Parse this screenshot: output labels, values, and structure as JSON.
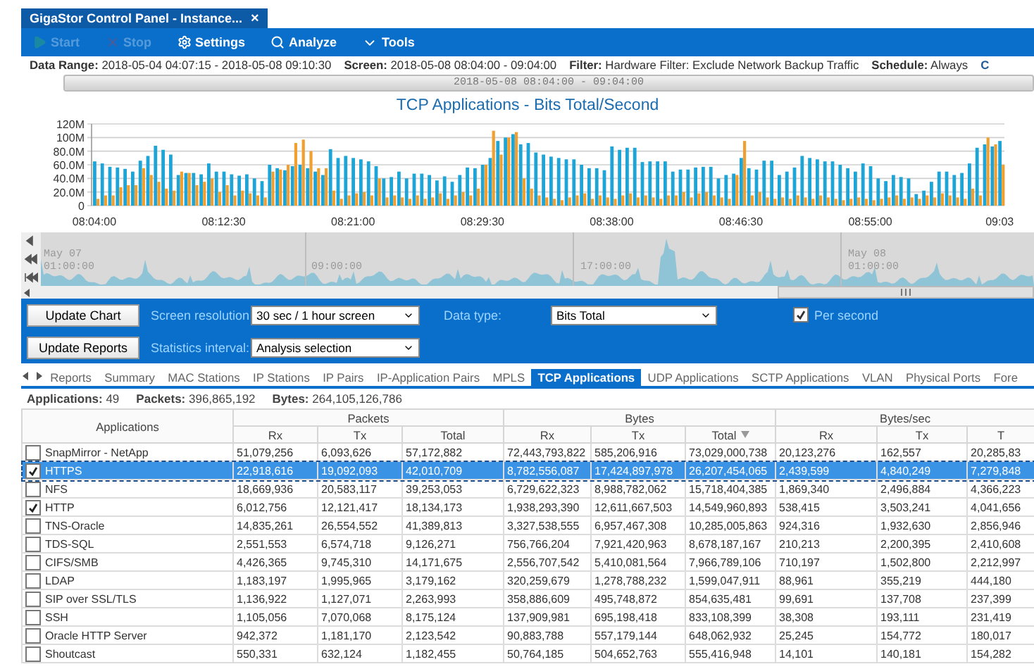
{
  "window": {
    "tab_title": "GigaStor Control Panel - Instance...",
    "close": "×"
  },
  "toolbar": [
    {
      "kind": "start",
      "label": "Start",
      "disabled": true
    },
    {
      "kind": "stop",
      "label": "Stop",
      "disabled": true
    },
    {
      "kind": "settings",
      "label": "Settings",
      "disabled": false
    },
    {
      "kind": "analyze",
      "label": "Analyze",
      "disabled": false
    },
    {
      "kind": "tools",
      "label": "Tools",
      "disabled": false
    }
  ],
  "info": [
    "**Data Range:** 2018-05-04 04:07:15 - 2018-05-08 09:10:30",
    "**Screen:** 2018-05-08 08:04:00 - 09:04:00",
    "**Filter:** Hardware Filter: Exclude Network Backup Traffic",
    "**Schedule:** Always"
  ],
  "info_overflow": "C",
  "range": {
    "text": "2018-05-08 08:04:00 - 09:04:00",
    "level": 1
  },
  "chart": {
    "chart_data": {
      "type": "bar",
      "title": "TCP Applications - Bits Total/Second",
      "ylim": [
        0,
        120
      ],
      "grid": true,
      "categories": [
        "08:04:00",
        null,
        null,
        null,
        null,
        null,
        null,
        null,
        null,
        null,
        null,
        null,
        null,
        null,
        null,
        null,
        null,
        "08:12:30",
        null,
        null,
        null,
        null,
        null,
        null,
        null,
        null,
        null,
        null,
        null,
        null,
        null,
        null,
        null,
        null,
        "08:21:00",
        null,
        null,
        null,
        null,
        null,
        null,
        null,
        null,
        null,
        null,
        null,
        null,
        null,
        null,
        null,
        null,
        "08:29:30",
        null,
        null,
        null,
        null,
        null,
        null,
        null,
        null,
        null,
        null,
        null,
        null,
        null,
        null,
        null,
        null,
        "08:38:00",
        null,
        null,
        null,
        null,
        null,
        null,
        null,
        null,
        null,
        null,
        null,
        null,
        null,
        null,
        null,
        null,
        "08:46:30",
        null,
        null,
        null,
        null,
        null,
        null,
        null,
        null,
        null,
        null,
        null,
        null,
        null,
        null,
        null,
        null,
        "08:55:00",
        null,
        null,
        null,
        null,
        null,
        null,
        null,
        null,
        null,
        null,
        null,
        null,
        null,
        null,
        null,
        null,
        "09:03"
      ],
      "yticks": [
        {
          "value": 0,
          "label": "0"
        },
        {
          "value": 20,
          "label": "20.0M"
        },
        {
          "value": 40,
          "label": "40.0M"
        },
        {
          "value": 60,
          "label": "60.0M"
        },
        {
          "value": 80,
          "label": "80.0M"
        },
        {
          "value": 100,
          "label": "100M"
        },
        {
          "value": 120,
          "label": "120M"
        }
      ],
      "series": [
        {
          "color": "#1ea5d8",
          "values": [
            65,
            62,
            57,
            56,
            54,
            50,
            66,
            73,
            88,
            82,
            75,
            45,
            48,
            48,
            46,
            62,
            50,
            50,
            46,
            44,
            46,
            40,
            36,
            60,
            55,
            52,
            58,
            60,
            55,
            50,
            45,
            83,
            70,
            73,
            70,
            68,
            65,
            58,
            40,
            42,
            50,
            40,
            47,
            47,
            45,
            37,
            43,
            35,
            45,
            56,
            55,
            60,
            70,
            95,
            100,
            105,
            90,
            92,
            78,
            75,
            72,
            70,
            68,
            68,
            60,
            55,
            55,
            52,
            87,
            82,
            85,
            85,
            64,
            65,
            65,
            65,
            50,
            53,
            53,
            56,
            57,
            57,
            40,
            45,
            47,
            70,
            55,
            53,
            66,
            66,
            45,
            50,
            56,
            73,
            70,
            68,
            65,
            65,
            60,
            55,
            50,
            62,
            58,
            40,
            36,
            45,
            42,
            40,
            17,
            22,
            35,
            50,
            50,
            45,
            48,
            62,
            85,
            90,
            87,
            95
          ]
        },
        {
          "color": "#f0a030",
          "values": [
            10,
            15,
            15,
            27,
            30,
            30,
            55,
            45,
            35,
            25,
            22,
            50,
            48,
            30,
            35,
            40,
            20,
            30,
            15,
            22,
            18,
            15,
            12,
            50,
            53,
            60,
            92,
            97,
            80,
            55,
            55,
            22,
            10,
            15,
            18,
            20,
            15,
            40,
            12,
            15,
            12,
            10,
            15,
            10,
            12,
            18,
            10,
            15,
            20,
            15,
            25,
            60,
            110,
            75,
            100,
            108,
            40,
            25,
            15,
            12,
            10,
            8,
            12,
            15,
            18,
            10,
            15,
            12,
            10,
            15,
            18,
            12,
            15,
            12,
            10,
            15,
            15,
            20,
            12,
            18,
            20,
            15,
            12,
            10,
            45,
            95,
            15,
            20,
            12,
            10,
            12,
            10,
            15,
            12,
            10,
            15,
            12,
            10,
            8,
            10,
            12,
            10,
            8,
            10,
            12,
            15,
            10,
            12,
            10,
            15,
            12,
            18,
            15,
            12,
            10,
            25,
            15,
            100,
            90,
            60
          ]
        }
      ]
    }
  },
  "overview": {
    "markers": [
      {
        "date": "May 07",
        "time": "01:00:00"
      },
      {
        "time": "09:00:00"
      },
      {
        "time": "17:00:00"
      },
      {
        "date": "May 08",
        "time": "01:00:00"
      }
    ]
  },
  "controls": {
    "buttons": [
      "Update Chart",
      "Update Reports"
    ],
    "screen_resolution": {
      "label": "Screen resolution",
      "value": "30 sec / 1 hour screen"
    },
    "statistics_interval": {
      "label": "Statistics interval:",
      "value": "Analysis selection"
    },
    "data_type": {
      "label": "Data type:",
      "value": "Bits Total"
    },
    "per_second": {
      "label": "Per second",
      "checked": true
    }
  },
  "tabs": [
    {
      "label": "Reports",
      "selected": false
    },
    {
      "label": "Summary",
      "selected": false
    },
    {
      "label": "MAC Stations",
      "selected": false
    },
    {
      "label": "IP Stations",
      "selected": false
    },
    {
      "label": "IP Pairs",
      "selected": false
    },
    {
      "label": "IP-Application Pairs",
      "selected": false
    },
    {
      "label": "MPLS",
      "selected": false
    },
    {
      "label": "TCP Applications",
      "selected": true
    },
    {
      "label": "UDP Applications",
      "selected": false
    },
    {
      "label": "SCTP Applications",
      "selected": false
    },
    {
      "label": "VLAN",
      "selected": false
    },
    {
      "label": "Physical Ports",
      "selected": false
    },
    {
      "label": "Fore",
      "selected": false
    }
  ],
  "summary": [
    "**Applications:** 49",
    "**Packets:** 396,865,192",
    "**Bytes:** 264,105,126,786"
  ],
  "table": {
    "first_column": "Applications",
    "groups": [
      {
        "label": "Packets",
        "columns": [
          {
            "label": "Rx",
            "sorted": false
          },
          {
            "label": "Tx",
            "sorted": false
          },
          {
            "label": "Total",
            "sorted": false
          }
        ]
      },
      {
        "label": "Bytes",
        "columns": [
          {
            "label": "Rx",
            "sorted": false
          },
          {
            "label": "Tx",
            "sorted": false
          },
          {
            "label": "Total",
            "sorted": true
          }
        ]
      },
      {
        "label": "Bytes/sec",
        "columns": [
          {
            "label": "Rx",
            "sorted": false
          },
          {
            "label": "Tx",
            "sorted": false
          },
          {
            "label": "T",
            "sorted": false
          }
        ]
      }
    ],
    "rows": [
      {
        "name": "SnapMirror - NetApp",
        "checked": false,
        "selected": false,
        "cells": [
          "51,079,256",
          "6,093,626",
          "57,172,882",
          "72,443,793,822",
          "585,206,916",
          "73,029,000,738",
          "20,123,276",
          "162,557",
          "20,285,83"
        ]
      },
      {
        "name": "HTTPS",
        "checked": true,
        "selected": true,
        "cells": [
          "22,918,616",
          "19,092,093",
          "42,010,709",
          "8,782,556,087",
          "17,424,897,978",
          "26,207,454,065",
          "2,439,599",
          "4,840,249",
          "7,279,848"
        ]
      },
      {
        "name": "NFS",
        "checked": false,
        "selected": false,
        "cells": [
          "18,669,936",
          "20,583,117",
          "39,253,053",
          "6,729,622,323",
          "8,988,782,062",
          "15,718,404,385",
          "1,869,340",
          "2,496,884",
          "4,366,223"
        ]
      },
      {
        "name": "HTTP",
        "checked": true,
        "selected": false,
        "cells": [
          "6,012,756",
          "12,121,417",
          "18,134,173",
          "1,938,293,390",
          "12,611,667,503",
          "14,549,960,893",
          "538,415",
          "3,503,241",
          "4,041,656"
        ]
      },
      {
        "name": "TNS-Oracle",
        "checked": false,
        "selected": false,
        "cells": [
          "14,835,261",
          "26,554,552",
          "41,389,813",
          "3,327,538,555",
          "6,957,467,308",
          "10,285,005,863",
          "924,316",
          "1,932,630",
          "2,856,946"
        ]
      },
      {
        "name": "TDS-SQL",
        "checked": false,
        "selected": false,
        "cells": [
          "2,551,553",
          "6,574,718",
          "9,126,271",
          "756,766,204",
          "7,921,420,963",
          "8,678,187,167",
          "210,213",
          "2,200,395",
          "2,410,608"
        ]
      },
      {
        "name": "CIFS/SMB",
        "checked": false,
        "selected": false,
        "cells": [
          "4,426,365",
          "9,745,310",
          "14,171,675",
          "2,556,707,542",
          "5,410,081,564",
          "7,966,789,106",
          "710,197",
          "1,502,800",
          "2,212,997"
        ]
      },
      {
        "name": "LDAP",
        "checked": false,
        "selected": false,
        "cells": [
          "1,183,197",
          "1,995,965",
          "3,179,162",
          "320,259,679",
          "1,278,788,232",
          "1,599,047,911",
          "88,961",
          "355,219",
          "444,180"
        ]
      },
      {
        "name": "SIP over SSL/TLS",
        "checked": false,
        "selected": false,
        "cells": [
          "1,136,922",
          "1,127,071",
          "2,263,993",
          "358,886,609",
          "495,748,872",
          "854,635,481",
          "99,691",
          "137,708",
          "237,399"
        ]
      },
      {
        "name": "SSH",
        "checked": false,
        "selected": false,
        "cells": [
          "1,105,056",
          "7,070,068",
          "8,175,124",
          "137,909,981",
          "695,198,418",
          "833,108,399",
          "38,308",
          "193,111",
          "231,419"
        ]
      },
      {
        "name": "Oracle HTTP Server",
        "checked": false,
        "selected": false,
        "cells": [
          "942,372",
          "1,181,170",
          "2,123,542",
          "90,883,788",
          "557,179,144",
          "648,062,932",
          "25,245",
          "154,772",
          "180,017"
        ]
      },
      {
        "name": "Shoutcast",
        "checked": false,
        "selected": false,
        "cells": [
          "550,331",
          "632,124",
          "1,182,455",
          "50,764,185",
          "504,652,763",
          "555,416,948",
          "14,101",
          "140,181",
          "154,282"
        ]
      }
    ]
  }
}
